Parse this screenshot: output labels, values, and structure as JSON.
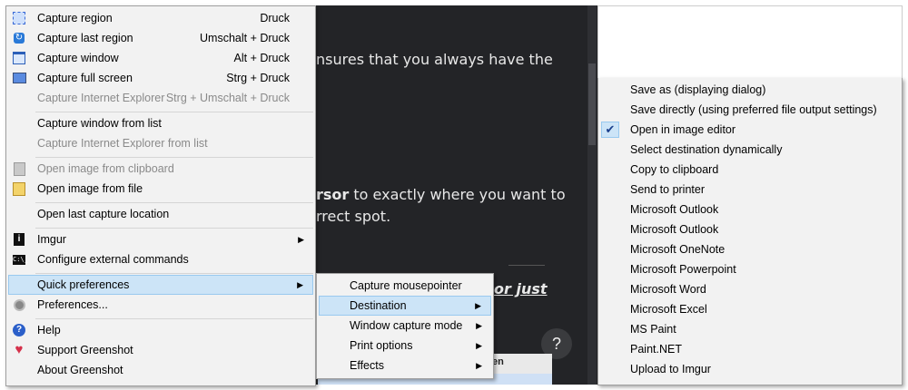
{
  "background": {
    "line1": "nsures that you always have the",
    "line2_bold": "rsor",
    "line2_rest": " to exactly where you want to",
    "line3": "rrect spot.",
    "line4": "or just",
    "help_glyph": "?",
    "panel_text": "en"
  },
  "main_menu": {
    "items": [
      {
        "label": "Capture region",
        "shortcut": "Druck",
        "icon": "region-icon"
      },
      {
        "label": "Capture last region",
        "shortcut": "Umschalt + Druck",
        "icon": "last-region-icon"
      },
      {
        "label": "Capture window",
        "shortcut": "Alt + Druck",
        "icon": "window-icon"
      },
      {
        "label": "Capture full screen",
        "shortcut": "Strg + Druck",
        "icon": "fullscreen-icon"
      },
      {
        "label": "Capture Internet Explorer",
        "shortcut": "Strg + Umschalt + Druck",
        "disabled": true
      },
      {
        "label": "Capture window from list"
      },
      {
        "label": "Capture Internet Explorer from list",
        "disabled": true
      },
      {
        "label": "Open image from clipboard",
        "disabled": true,
        "icon": "clipboard-icon"
      },
      {
        "label": "Open image from file",
        "icon": "file-icon"
      },
      {
        "label": "Open last capture location"
      },
      {
        "label": "Imgur",
        "submenu": true,
        "icon": "imgur-icon"
      },
      {
        "label": "Configure external commands",
        "icon": "cmd-icon"
      },
      {
        "label": "Quick preferences",
        "submenu": true,
        "selected": true
      },
      {
        "label": "Preferences...",
        "icon": "gear-icon"
      },
      {
        "label": "Help",
        "icon": "help-icon"
      },
      {
        "label": "Support Greenshot",
        "icon": "heart-icon"
      },
      {
        "label": "About Greenshot"
      }
    ]
  },
  "quick_prefs_menu": {
    "items": [
      {
        "label": "Capture mousepointer"
      },
      {
        "label": "Destination",
        "submenu": true,
        "selected": true
      },
      {
        "label": "Window capture mode",
        "submenu": true
      },
      {
        "label": "Print options",
        "submenu": true
      },
      {
        "label": "Effects",
        "submenu": true
      }
    ]
  },
  "destination_menu": {
    "check_glyph": "✔",
    "items": [
      {
        "label": "Save as (displaying dialog)"
      },
      {
        "label": "Save directly (using preferred file output settings)"
      },
      {
        "label": "Open in image editor",
        "checked": true
      },
      {
        "label": "Select destination dynamically"
      },
      {
        "label": "Copy to clipboard"
      },
      {
        "label": "Send to printer"
      },
      {
        "label": "Microsoft Outlook"
      },
      {
        "label": "Microsoft Outlook"
      },
      {
        "label": "Microsoft OneNote"
      },
      {
        "label": "Microsoft Powerpoint"
      },
      {
        "label": "Microsoft Word"
      },
      {
        "label": "Microsoft Excel"
      },
      {
        "label": "MS Paint"
      },
      {
        "label": "Paint.NET"
      },
      {
        "label": "Upload to Imgur"
      }
    ]
  }
}
